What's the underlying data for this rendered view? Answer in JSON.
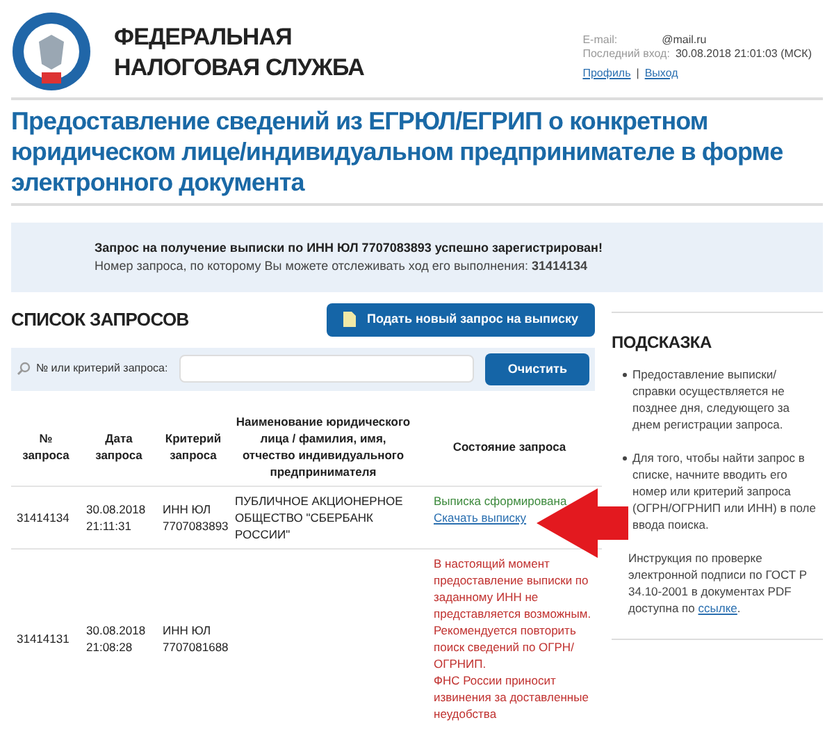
{
  "header": {
    "org_name": [
      "ФЕДЕРАЛЬНАЯ",
      "НАЛОГОВАЯ СЛУЖБА"
    ],
    "email_label": "E-mail:",
    "email_value": "@mail.ru",
    "last_login_label": "Последний вход:",
    "last_login_value": "30.08.2018 21:01:03 (МСК)",
    "links": [
      "Профиль",
      "Выход"
    ],
    "separator": "|"
  },
  "page_title": "Предоставление сведений из ЕГРЮЛ/ЕГРИП о конкретном юридическом лице/индивидуальном предпринимателе в форме электронного документа",
  "notice": {
    "line1": "Запрос на получение выписки по ИНН ЮЛ 7707083893 успешно зарегистрирован!",
    "line2": "Номер запроса, по которому Вы можете отслеживать ход его выполнения: **31414134**"
  },
  "requests": {
    "title": "СПИСОК ЗАПРОСОВ",
    "new_button": "Подать новый запрос на выписку",
    "search_label": "№ или критерий запроса:",
    "clear_button": "Очистить",
    "columns": [
      "№ запроса",
      "Дата запроса",
      "Критерий запроса",
      "Наименование юридического лица / фамилия, имя, отчество индивидуального предпринимателя",
      "Состояние запроса"
    ],
    "rows": [
      {
        "number": "31414134",
        "date": "30.08.2018 21:11:31",
        "criterion": "ИНН ЮЛ 7707083893",
        "name": "ПУБЛИЧНОЕ АКЦИОНЕРНОЕ ОБЩЕСТВО \"СБЕРБАНК РОССИИ\"",
        "status": {
          "kind": "ready",
          "text": "Выписка сформирована",
          "link": "Скачать выписку"
        }
      },
      {
        "number": "31414131",
        "date": "30.08.2018 21:08:28",
        "criterion": "ИНН ЮЛ 7707081688",
        "status": {
          "kind": "error",
          "paragraphs": [
            "В настоящий момент предоставление выписки по заданному ИНН не представляется возможным. Рекомендуется повторить поиск сведений по ОГРН/ОГРНИП.",
            "ФНС России приносит извинения за доставленные неудобства"
          ]
        }
      }
    ]
  },
  "hint": {
    "title": "ПОДСКАЗКА",
    "items": [
      {
        "text": "Предоставление выписки/справки осуществляется не позднее дня, следующего за днем регистрации запроса."
      },
      {
        "text": "Для того, чтобы найти запрос в списке, начните вводить его номер или критерий запроса (ОГРН/ОГРНИП или ИНН) в поле ввода поиска."
      }
    ],
    "note": "Инструкция по проверке электронной подписи по ГОСТ Р 34.10-2001 в документах PDF доступна по",
    "note_link": "ссылке",
    "note_end": "."
  }
}
